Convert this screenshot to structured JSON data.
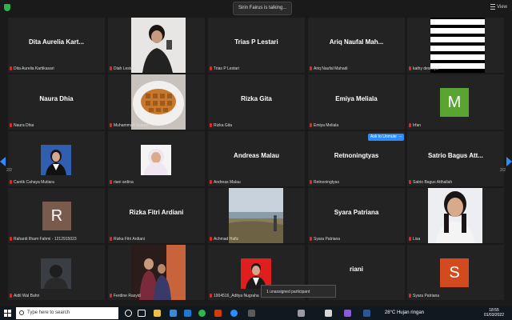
{
  "topbar": {
    "talking": "Sirin Fairus is talking...",
    "view_label": "View"
  },
  "nav": {
    "page_left": "2/2",
    "page_right": "2/2"
  },
  "unmute": {
    "ask_label": "Ask to Unmute",
    "more_label": "..."
  },
  "participants": [
    {
      "big": "Dita Aurelia Kart...",
      "label": "Dita Aurelia Kartikasari"
    },
    {
      "big": "",
      "label": "Diah Lestari"
    },
    {
      "big": "Trias P Lestari",
      "label": "Trias P Lestari"
    },
    {
      "big": "Ariq Naufal Mah...",
      "label": "Ariq Naufal Mahadi"
    },
    {
      "big": "",
      "label": "kathy desintya"
    },
    {
      "big": "Naura Dhia",
      "label": "Naura Dhia"
    },
    {
      "big": "",
      "label": "Muhammad Syauqi"
    },
    {
      "big": "Rizka Gita",
      "label": "Rizka Gita"
    },
    {
      "big": "Emiya Meliala",
      "label": "Emiya Meliala"
    },
    {
      "big": "",
      "label": "Irfan",
      "avatar": "M"
    },
    {
      "big": "",
      "label": "Cantik Cahaya Mutiara"
    },
    {
      "big": "",
      "label": "riani ardina"
    },
    {
      "big": "Andreas Malau",
      "label": "Andreas Malau"
    },
    {
      "big": "Retnoningtyas",
      "label": "Retnoningtyas"
    },
    {
      "big": "Satrio Bagus Att...",
      "label": "Satrio Bagus Atthallah"
    },
    {
      "big": "",
      "label": "Rahardi Ilham Fahmi - 1212915023",
      "avatar": "R"
    },
    {
      "big": "Rizka Fitri Ardiani",
      "label": "Rizka Fitri Ardiani"
    },
    {
      "big": "",
      "label": "Achmad Hafiz"
    },
    {
      "big": "Syara Patriana",
      "label": "Syara Patriana"
    },
    {
      "big": "",
      "label": "Lisa"
    },
    {
      "big": "",
      "label": "Aidil Wal Bahri"
    },
    {
      "big": "",
      "label": "Ferdine Rasyid"
    },
    {
      "big": "",
      "label": "1904516_Aditya Nugraha"
    },
    {
      "big": "riani",
      "label": ""
    },
    {
      "big": "",
      "label": "Syara Patriana",
      "avatar": "S"
    }
  ],
  "unassigned": "1 unassigned participant",
  "taskbar": {
    "search_placeholder": "Type here to search",
    "weather": "28°C  Hujan ringan",
    "time": "18:55",
    "date": "01/03/2022"
  },
  "colors": {
    "accent": "#2d8cff",
    "avatar_m": "#5aa431",
    "avatar_r": "#7b5a4e",
    "avatar_s": "#d24a1e"
  }
}
